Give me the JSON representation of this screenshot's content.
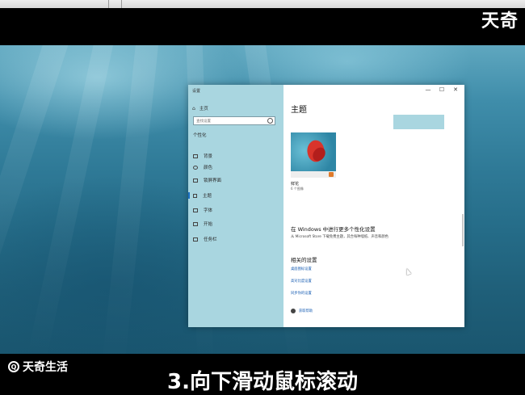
{
  "watermark": {
    "top_right": "天奇",
    "bottom_left": "天奇生活"
  },
  "caption": "3.向下滑动鼠标滚动",
  "window": {
    "title": "设置",
    "controls": {
      "minimize": "—",
      "maximize": "☐",
      "close": "✕"
    },
    "sidebar": {
      "home_label": "主页",
      "search_placeholder": "查找设置",
      "section_title": "个性化",
      "items": [
        {
          "label": "背景",
          "icon": "picture-icon"
        },
        {
          "label": "颜色",
          "icon": "palette-icon"
        },
        {
          "label": "锁屏界面",
          "icon": "monitor-icon"
        },
        {
          "label": "主题",
          "icon": "brush-icon",
          "active": true
        },
        {
          "label": "字体",
          "icon": "font-icon"
        },
        {
          "label": "开始",
          "icon": "start-icon"
        },
        {
          "label": "任务栏",
          "icon": "taskbar-icon"
        }
      ]
    },
    "main": {
      "heading": "主题",
      "theme_name": "鲜花",
      "theme_count": "6 个图像",
      "more_heading": "在 Windows 中进行更多个性化设置",
      "more_sub": "从 Microsoft Store 下载免费主题，其合每种墙纸、声音和颜色",
      "related_heading": "相关的设置",
      "links": [
        "桌面图标设置",
        "高对比度设置",
        "同步你的设置"
      ],
      "help": "获取帮助"
    }
  }
}
